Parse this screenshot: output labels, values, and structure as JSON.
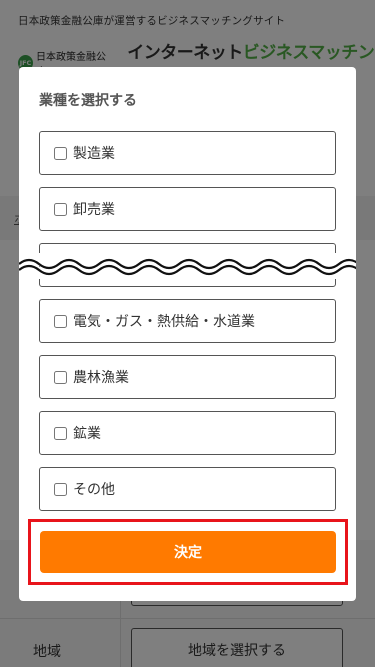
{
  "site": {
    "tagline": "日本政策金融公庫が運営するビジネスマッチングサイト",
    "org_badge": "JFC",
    "org_name": "日本政策金融公庫",
    "logo_part1": "インターネット",
    "logo_part2": "ビジネスマッチング"
  },
  "background": {
    "band_link": "ホ",
    "region_label": "地域",
    "region_button": "地域を選択する"
  },
  "modal": {
    "title": "業種を選択する",
    "options_top": [
      {
        "label": "製造業",
        "checked": false
      },
      {
        "label": "卸売業",
        "checked": false
      }
    ],
    "options_bottom": [
      {
        "label": "電気・ガス・熱供給・水道業",
        "checked": false
      },
      {
        "label": "農林漁業",
        "checked": false
      },
      {
        "label": "鉱業",
        "checked": false
      },
      {
        "label": "その他",
        "checked": false
      }
    ],
    "decide_label": "決定"
  },
  "colors": {
    "accent_orange": "#ff7a00",
    "highlight_red": "#e8141b",
    "logo_green": "#53b046"
  }
}
